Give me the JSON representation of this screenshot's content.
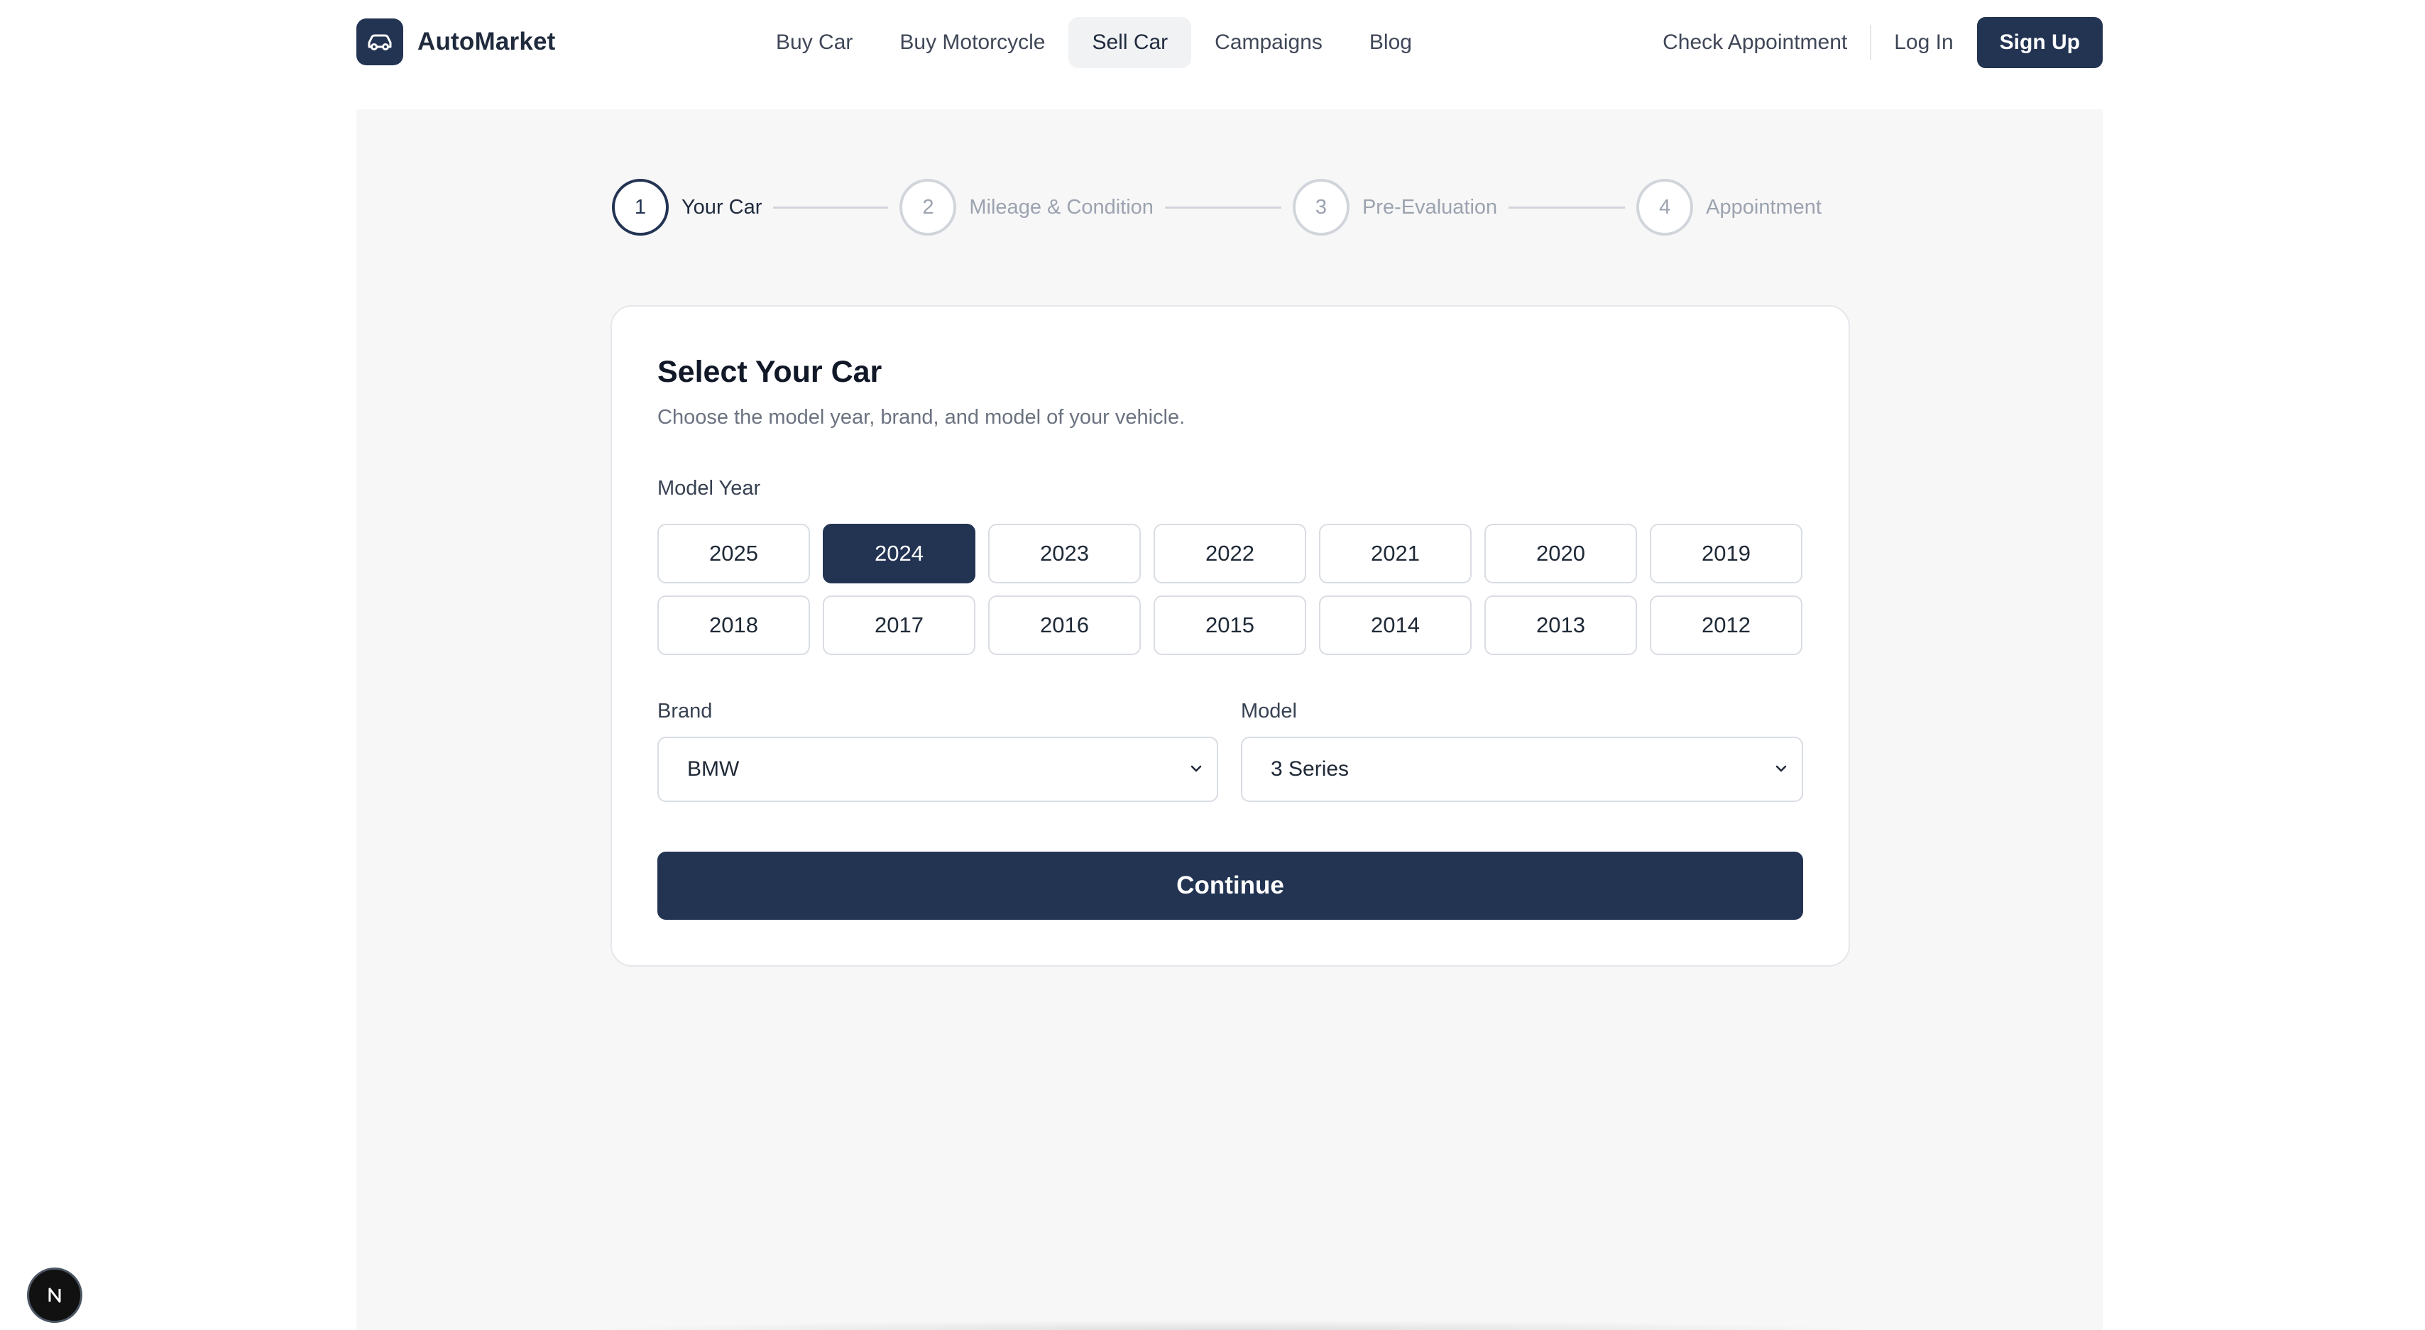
{
  "header": {
    "brand": "AutoMarket",
    "nav": [
      "Buy Car",
      "Buy Motorcycle",
      "Sell Car",
      "Campaigns",
      "Blog"
    ],
    "active_nav": "Sell Car",
    "check_appointment": "Check Appointment",
    "log_in": "Log In",
    "sign_up": "Sign Up"
  },
  "stepper": {
    "steps": [
      {
        "number": "1",
        "label": "Your Car"
      },
      {
        "number": "2",
        "label": "Mileage & Condition"
      },
      {
        "number": "3",
        "label": "Pre-Evaluation"
      },
      {
        "number": "4",
        "label": "Appointment"
      }
    ],
    "active_step": 1
  },
  "card": {
    "title": "Select Your Car",
    "subtitle": "Choose the model year, brand, and model of your vehicle.",
    "model_year_label": "Model Year",
    "years": [
      "2025",
      "2024",
      "2023",
      "2022",
      "2021",
      "2020",
      "2019",
      "2018",
      "2017",
      "2016",
      "2015",
      "2014",
      "2013",
      "2012"
    ],
    "selected_year": "2024",
    "brand_label": "Brand",
    "brand_value": "BMW",
    "model_label": "Model",
    "model_value": "3 Series",
    "continue_label": "Continue"
  },
  "icons": {
    "logo": "car-icon",
    "select_chevron": "chevron-down-icon",
    "dev_badge": "next-logo-icon"
  },
  "colors": {
    "primary": "#233453",
    "panel_bg": "#f7f7f8"
  }
}
